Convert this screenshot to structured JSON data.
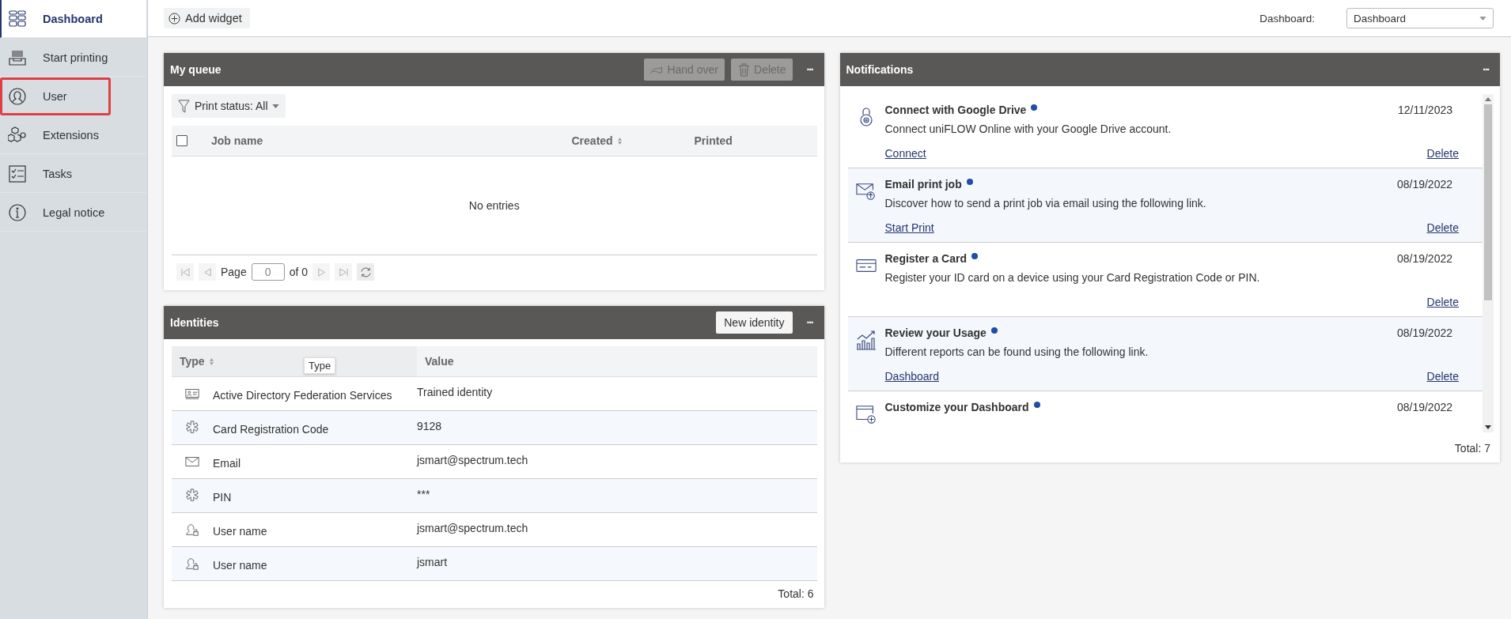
{
  "sidebar": {
    "items": [
      {
        "label": "Dashboard",
        "kind": "dashboard",
        "selected": true,
        "highlighted": false
      },
      {
        "label": "Start printing",
        "kind": "printer",
        "selected": false,
        "highlighted": false
      },
      {
        "label": "User",
        "kind": "user",
        "selected": false,
        "highlighted": true
      },
      {
        "label": "Extensions",
        "kind": "cubes",
        "selected": false,
        "highlighted": false
      },
      {
        "label": "Tasks",
        "kind": "tasks",
        "selected": false,
        "highlighted": false
      },
      {
        "label": "Legal notice",
        "kind": "info",
        "selected": false,
        "highlighted": false
      }
    ]
  },
  "toolbar": {
    "add_widget": "Add widget",
    "dashboard_label": "Dashboard:",
    "dashboard_value": "Dashboard"
  },
  "my_queue": {
    "title": "My queue",
    "hand_over": "Hand over",
    "delete": "Delete",
    "more": "···",
    "filter": "Print status: All",
    "columns": [
      {
        "label": "Job name",
        "sortable": false
      },
      {
        "label": "Created",
        "sortable": true
      },
      {
        "label": "Printed",
        "sortable": false
      }
    ],
    "select_all_checked": false,
    "empty": "No entries",
    "pager": {
      "page_label": "Page",
      "page_value": "0",
      "of": "of 0"
    }
  },
  "identities": {
    "title": "Identities",
    "new": "New identity",
    "more": "···",
    "columns": [
      {
        "label": "Type",
        "sortable": true
      },
      {
        "label": "Value",
        "sortable": false
      }
    ],
    "tooltip": "Type",
    "rows": [
      {
        "kind": "id-card",
        "type": "Active Directory Federation Services",
        "value": "Trained identity"
      },
      {
        "kind": "code",
        "type": "Card Registration Code",
        "value": "9128"
      },
      {
        "kind": "email",
        "type": "Email",
        "value": "jsmart@spectrum.tech"
      },
      {
        "kind": "code",
        "type": "PIN",
        "value": "***"
      },
      {
        "kind": "user-lock",
        "type": "User name",
        "value": "jsmart@spectrum.tech"
      },
      {
        "kind": "user-lock",
        "type": "User name",
        "value": "jsmart"
      }
    ],
    "total": "Total: 6"
  },
  "notifications": {
    "title": "Notifications",
    "more": "···",
    "items": [
      {
        "kind": "lock",
        "title": "Connect with Google Drive",
        "unread": true,
        "date": "12/11/2023",
        "text": "Connect uniFLOW Online with your Google Drive account.",
        "link": "Connect",
        "delete": "Delete"
      },
      {
        "kind": "mail-upload",
        "title": "Email print job",
        "unread": true,
        "date": "08/19/2022",
        "text": "Discover how to send a print job via email using the following link.",
        "link": "Start Print",
        "delete": "Delete"
      },
      {
        "kind": "card",
        "title": "Register a Card",
        "unread": true,
        "date": "08/19/2022",
        "text": "Register your ID card on a device using your Card Registration Code or PIN.",
        "delete": "Delete"
      },
      {
        "kind": "chart",
        "title": "Review your Usage",
        "unread": true,
        "date": "08/19/2022",
        "text": "Different reports can be found using the following link.",
        "link": "Dashboard",
        "delete": "Delete"
      },
      {
        "kind": "window-add",
        "title": "Customize your Dashboard",
        "unread": true,
        "date": "08/19/2022"
      }
    ],
    "total": "Total: 7"
  }
}
